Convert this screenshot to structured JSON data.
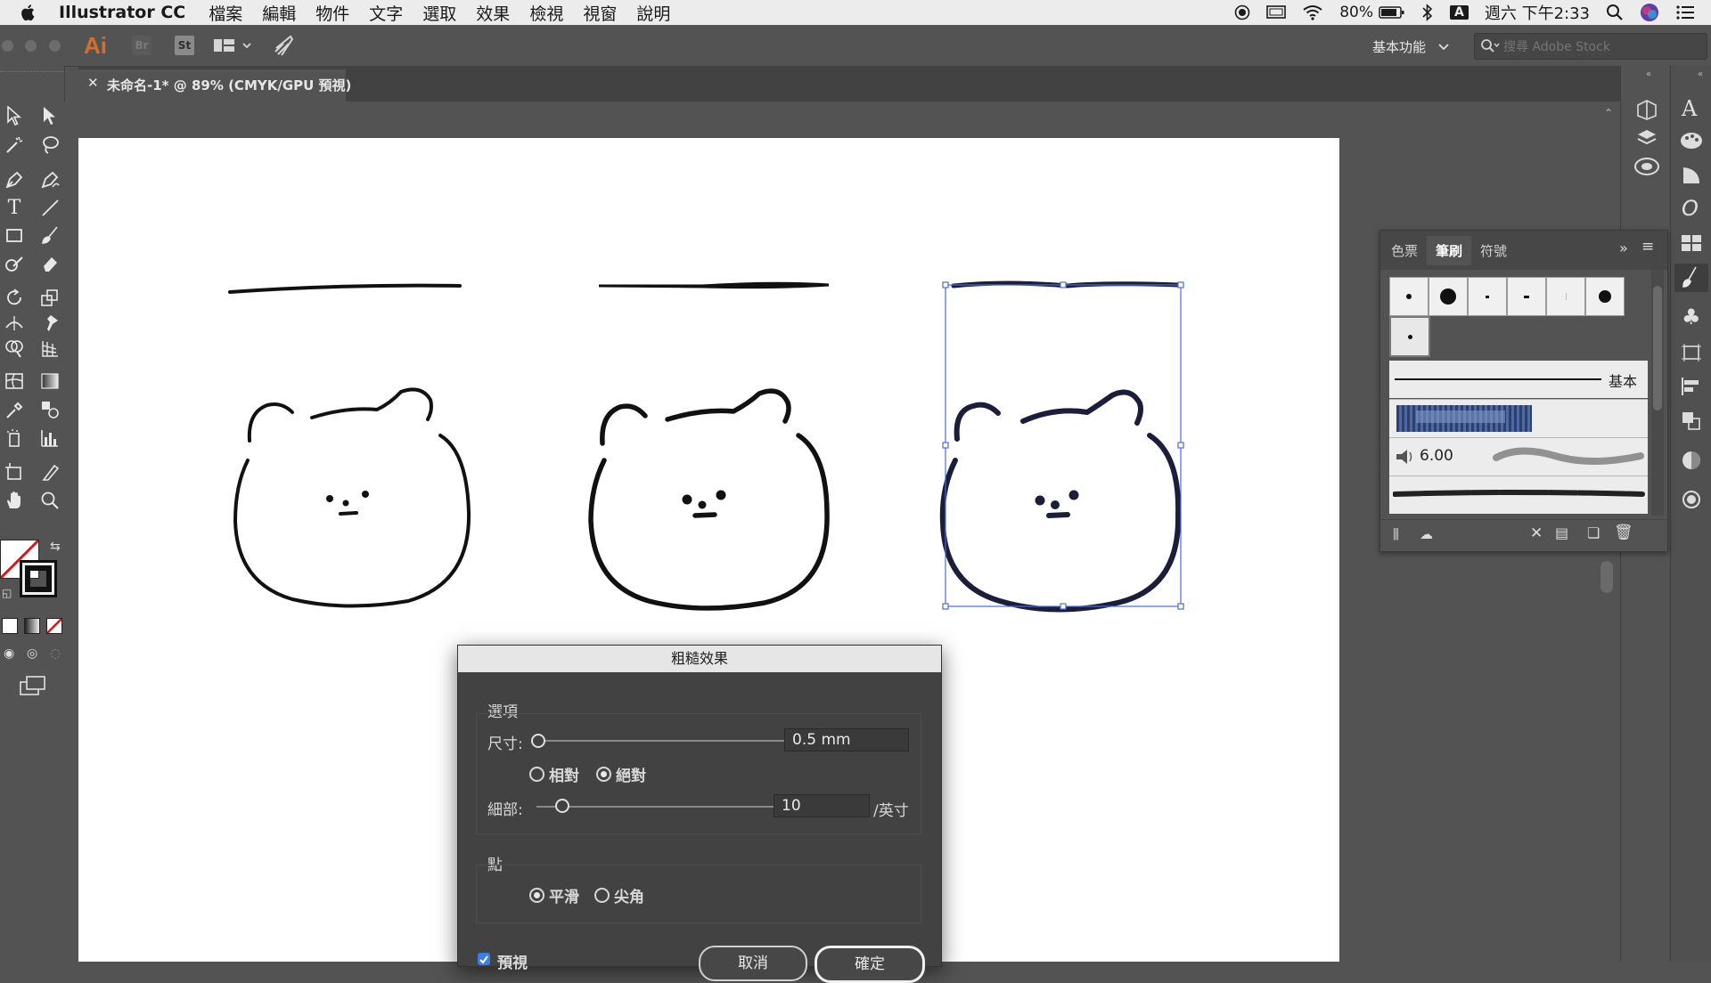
{
  "menubar": {
    "app_name": "Illustrator CC",
    "items": [
      "檔案",
      "編輯",
      "物件",
      "文字",
      "選取",
      "效果",
      "檢視",
      "視窗",
      "說明"
    ],
    "battery": "80%",
    "input_indicator": "A",
    "clock": "週六 下午2:33"
  },
  "appbar": {
    "logo": "Ai",
    "bridge": "Br",
    "stock_app": "St",
    "workspace": "基本功能",
    "search_placeholder": "搜尋 Adobe Stock"
  },
  "document_tab": {
    "title": "未命名-1* @ 89% (CMYK/GPU 預視)"
  },
  "brush_panel": {
    "tabs": [
      "色票",
      "筆刷",
      "符號"
    ],
    "active_tab": "筆刷",
    "basic_label": "基本",
    "stroke_value": "6.00"
  },
  "roughen_dialog": {
    "title": "粗糙效果",
    "options_header": "選項",
    "size_label": "尺寸:",
    "size_value": "0.5 mm",
    "size_slider_fraction": 0.0,
    "relative_label": "相對",
    "absolute_label": "絕對",
    "detail_label": "細部:",
    "detail_value": "10",
    "detail_unit": "/英寸",
    "detail_slider_fraction": 0.1,
    "points_header": "點",
    "smooth_label": "平滑",
    "corner_label": "尖角",
    "preview_label": "預視",
    "cancel_label": "取消",
    "ok_label": "確定"
  },
  "colors": {
    "menubar_bg": "#ececec",
    "app_bg": "#535353",
    "ai_logo": "#d46e2d",
    "selection_blue": "#4a6fd6"
  }
}
